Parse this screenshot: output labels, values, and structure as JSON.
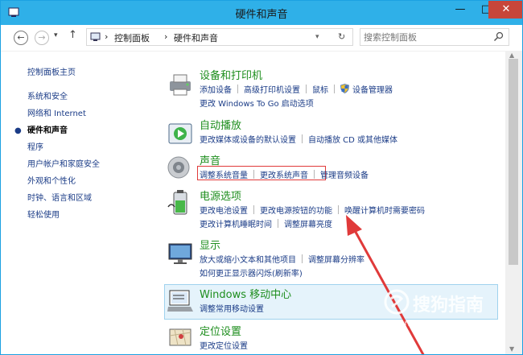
{
  "window": {
    "title": "硬件和声音",
    "controls": {
      "minimize": "—",
      "maximize": "□",
      "close": "✕"
    }
  },
  "address": {
    "crumbs": [
      "控制面板",
      "硬件和声音"
    ],
    "search_placeholder": "搜索控制面板"
  },
  "sidebar": {
    "items": [
      {
        "label": "控制面板主页"
      },
      {
        "label": "系统和安全"
      },
      {
        "label": "网络和 Internet"
      },
      {
        "label": "硬件和声音"
      },
      {
        "label": "程序"
      },
      {
        "label": "用户帐户和家庭安全"
      },
      {
        "label": "外观和个性化"
      },
      {
        "label": "时钟、语言和区域"
      },
      {
        "label": "轻松使用"
      }
    ]
  },
  "categories": [
    {
      "title": "设备和打印机",
      "icon": "printer-icon",
      "links": [
        [
          "添加设备",
          "高级打印机设置",
          "鼠标",
          "设备管理器"
        ],
        [
          "更改 Windows To Go 启动选项"
        ]
      ]
    },
    {
      "title": "自动播放",
      "icon": "autoplay-icon",
      "links": [
        [
          "更改媒体或设备的默认设置",
          "自动播放 CD 或其他媒体"
        ]
      ]
    },
    {
      "title": "声音",
      "icon": "speaker-icon",
      "links": [
        [
          "调整系统音量",
          "更改系统声音",
          "管理音频设备"
        ]
      ]
    },
    {
      "title": "电源选项",
      "icon": "battery-icon",
      "links": [
        [
          "更改电池设置",
          "更改电源按钮的功能",
          "唤醒计算机时需要密码"
        ],
        [
          "更改计算机睡眠时间",
          "调整屏幕亮度"
        ]
      ]
    },
    {
      "title": "显示",
      "icon": "monitor-icon",
      "links": [
        [
          "放大或缩小文本和其他项目",
          "调整屏幕分辨率"
        ],
        [
          "如何更正显示器闪烁(刷新率)"
        ]
      ]
    },
    {
      "title": "Windows 移动中心",
      "icon": "mobility-center-icon",
      "links": [
        [
          "调整常用移动设置"
        ]
      ]
    },
    {
      "title": "定位设置",
      "icon": "location-icon",
      "links": [
        [
          "更改定位设置"
        ]
      ]
    }
  ],
  "watermark": {
    "brand": "搜狗指南",
    "url": "zhinan.sogou.com"
  },
  "colors": {
    "titlebar": "#2fb0e8",
    "link": "#1b3c87",
    "heading": "#1e8e1e",
    "annotation": "#e03a3a"
  }
}
